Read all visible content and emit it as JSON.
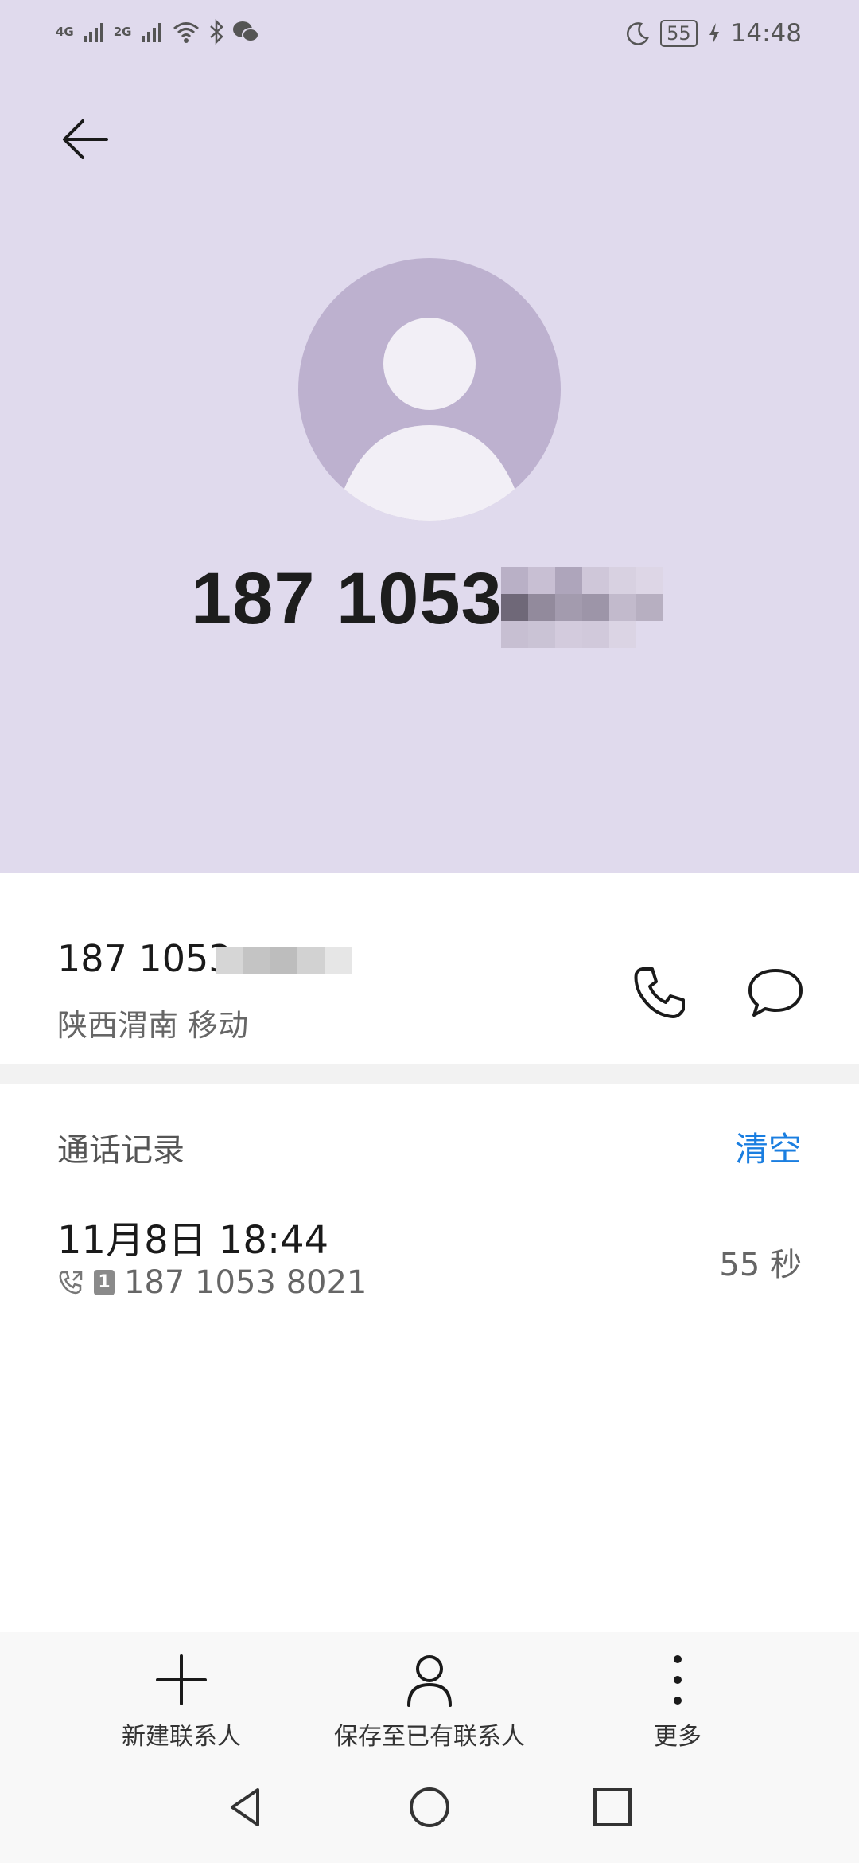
{
  "status_bar": {
    "network_1": "4G",
    "network_2": "2G",
    "battery": "55",
    "time": "14:48",
    "icons": [
      "signal-icon",
      "wifi-icon",
      "bluetooth-icon",
      "wechat-icon",
      "moon-icon",
      "charging-icon"
    ]
  },
  "header": {
    "number_visible": "187 1053",
    "background_color": "#e0daed",
    "avatar_color": "#bdb1cf"
  },
  "contact": {
    "number_visible": "187 1053",
    "location": "陕西渭南 移动"
  },
  "call_log": {
    "title": "通话记录",
    "clear_label": "清空",
    "entries": [
      {
        "datetime": "11月8日 18:44",
        "sim": "1",
        "number": "187 1053 8021",
        "duration": "55 秒"
      }
    ]
  },
  "bottom_actions": [
    {
      "label": "新建联系人",
      "icon": "plus-icon"
    },
    {
      "label": "保存至已有联系人",
      "icon": "person-icon"
    },
    {
      "label": "更多",
      "icon": "more-vertical-icon"
    }
  ],
  "accent_color": "#1a7ee0"
}
